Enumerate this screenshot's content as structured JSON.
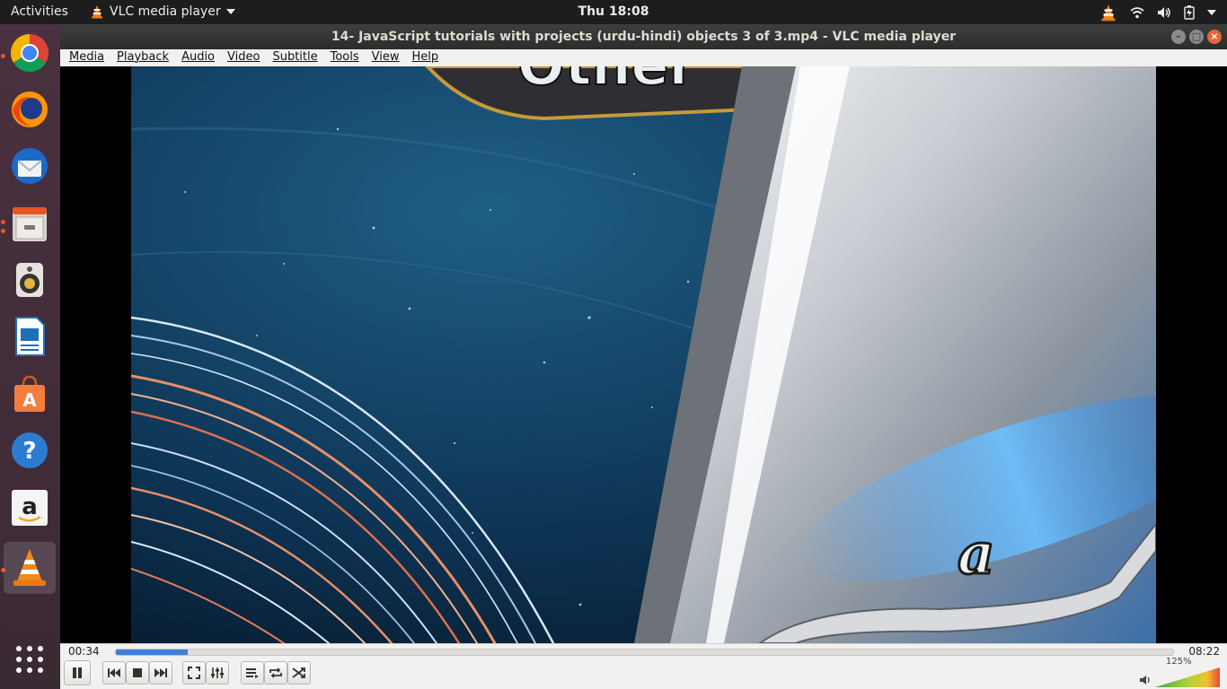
{
  "topbar": {
    "activities": "Activities",
    "app_name": "VLC media player",
    "clock": "Thu 18:08"
  },
  "dock": {
    "apps": [
      "Chromium Web Browser",
      "Firefox Web Browser",
      "Thunderbird Mail",
      "Files",
      "Rhythmbox",
      "LibreOffice Writer",
      "Ubuntu Software",
      "Help",
      "Amazon",
      "VLC media player",
      "Show Applications"
    ]
  },
  "window": {
    "title": "14- JavaScript tutorials with projects (urdu-hindi) objects 3 of 3.mp4 - VLC media player"
  },
  "menu": {
    "media": "Media",
    "playback": "Playback",
    "audio": "Audio",
    "video": "Video",
    "subtitle": "Subtitle",
    "tools": "Tools",
    "view": "View",
    "help": "Help"
  },
  "player": {
    "elapsed": "00:34",
    "total": "08:22",
    "progress_fraction": 0.068,
    "volume": "125%"
  },
  "colors": {
    "accent": "#e95420",
    "seek": "#3b82d6"
  }
}
